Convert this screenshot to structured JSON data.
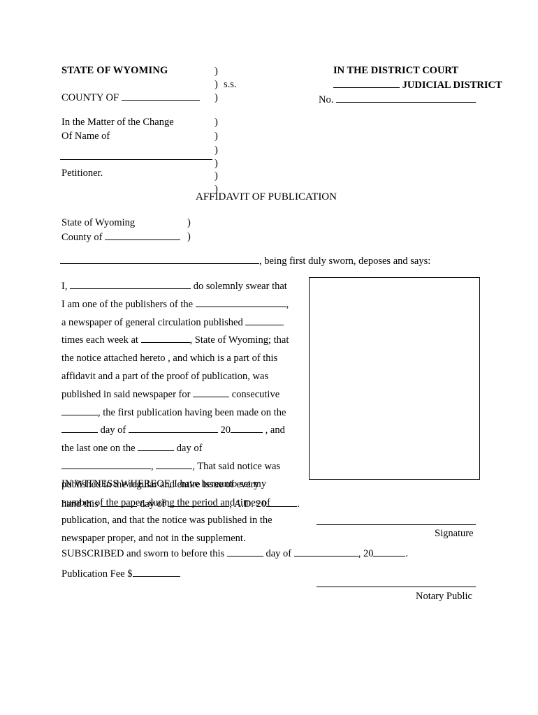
{
  "document": {
    "header": {
      "state": "STATE OF WYOMING",
      "county_label": "COUNTY OF",
      "county_blank": "",
      "ss": ") s.s.",
      "paren": ")",
      "court": "IN THE DISTRICT COURT",
      "judicial_district": "JUDICIAL DISTRICT",
      "judicial_blank": "___________",
      "no_label": "No.",
      "no_blank": ""
    },
    "matter": {
      "line1": "In the Matter of the Change",
      "line2": "Of Name of",
      "blank": "",
      "petitioner": "Petitioner."
    },
    "title": "AFFIDAVIT OF PUBLICATION",
    "venue": {
      "state_label": "State of Wyoming",
      "county_label": "County of",
      "county_blank": "",
      "paren": ")"
    },
    "sworn_statement": ", being first duly sworn, deposes and says:",
    "body": {
      "line01_a": "I,",
      "line01_b": "do solemnly swear that",
      "line02_a": "I am one of the publishers of the",
      "line02_b": ",",
      "line03_a": "a  newspaper  of  general  circulation  published",
      "line04_a": "times  each  week  at",
      "line04_b": ",  State  of  Wyoming;  that",
      "line05": "the  notice  attached  hereto ,  and  which  is  a  part  of  this",
      "line06": "affidavit  and  a  part  of  the  proof  of  publication,  was",
      "line07_a": "published  in  said  newspaper  for",
      "line07_b": "consecutive",
      "line08_b": ",  the  first  publication  having  been  made  on  the",
      "line09_a": "day  of",
      "line09_b": "20",
      "line09_c": ",  and",
      "line10_a": "the      last      one      on      the",
      "line10_b": "day      of",
      "line11_b": ",",
      "line11_c": ",  That  said  notice  was",
      "line12": "published  in  the  regular  and  entire  issue  of   every",
      "line13": "number  of  the  paper,  during  the  period  and  times  of",
      "line14": "publication,  and  that  the  notice  was  published  in  the",
      "line15": "newspaper  proper,  and  not  in  the  supplement."
    },
    "witness": {
      "line1": "IN WITNESS WHEREOF, I have hereunto set my",
      "line2_a": "hand this",
      "line2_b": "day of",
      "line2_c": ", A.D. 20",
      "line2_d": "."
    },
    "signature_label": "Signature",
    "subscribed": {
      "text_a": "SUBSCRIBED and sworn to before this",
      "text_b": "day of",
      "text_c": ", 20",
      "text_d": "."
    },
    "publication_fee": "Publication Fee $",
    "notary_label": "Notary Public"
  }
}
